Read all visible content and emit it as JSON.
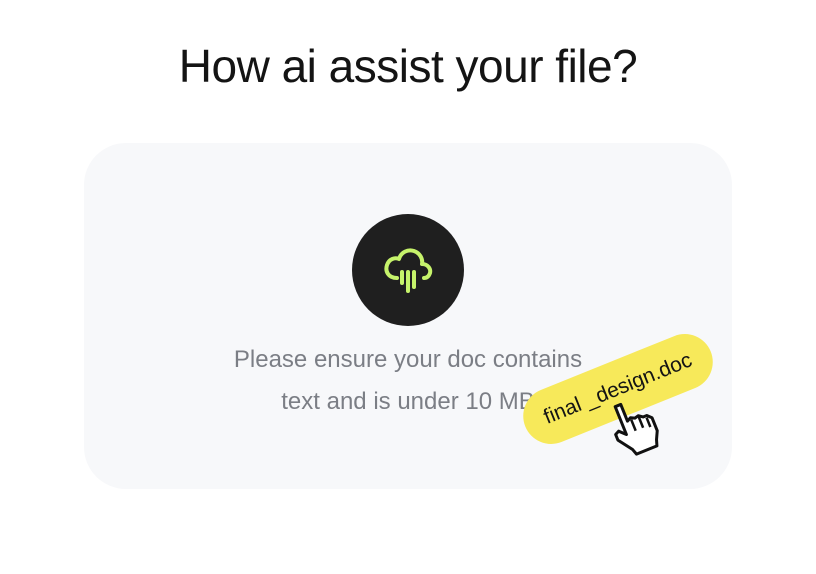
{
  "heading": "How ai assist your file?",
  "dropzone": {
    "icon": "cloud-rain-upload-icon",
    "helper_line_1": "Please ensure your doc contains",
    "helper_line_2": "text and is under 10 MB",
    "dragged_file_name": "final _design.doc",
    "cursor": "hand-pointer-cursor-icon"
  },
  "colors": {
    "icon_accent": "#c6f36b",
    "icon_bg": "#1f1f1f",
    "chip_bg": "#f7e95a",
    "dropzone_bg": "#f7f8fa"
  }
}
